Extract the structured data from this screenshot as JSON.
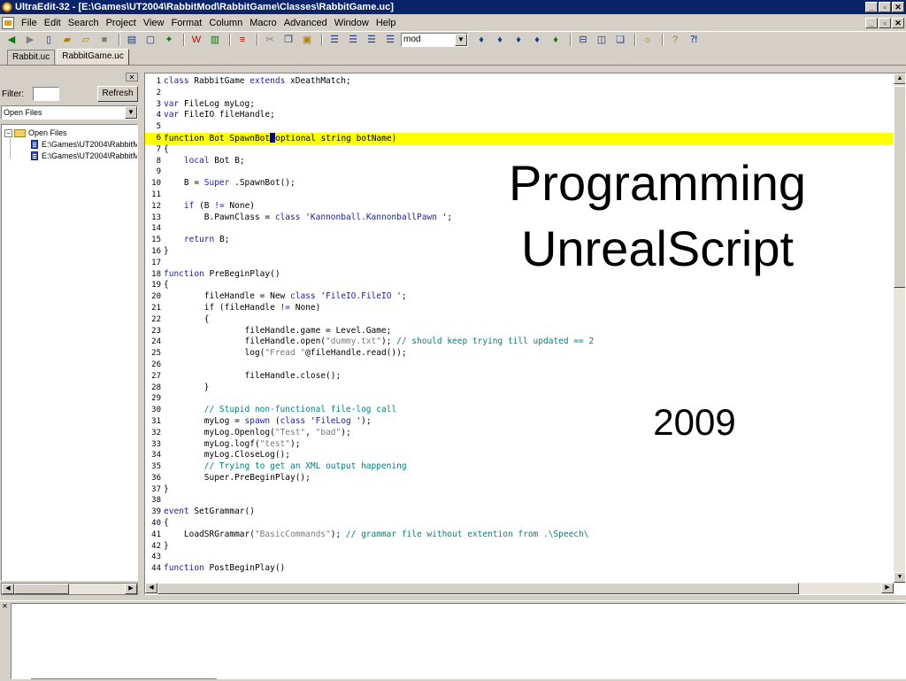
{
  "window": {
    "title": "UltraEdit-32 - [E:\\Games\\UT2004\\RabbitMod\\RabbitGame\\Classes\\RabbitGame.uc]",
    "buttons": [
      "_",
      "▫",
      "✕"
    ]
  },
  "menu": {
    "items": [
      "File",
      "Edit",
      "Search",
      "Project",
      "View",
      "Format",
      "Column",
      "Macro",
      "Advanced",
      "Window",
      "Help"
    ]
  },
  "toolbar": {
    "search_combo_value": "mod"
  },
  "tabs": [
    "Rabbit.uc",
    "RabbitGame.uc"
  ],
  "left_pane": {
    "filter_label": "Filter:",
    "refresh_label": "Refresh",
    "view_select": "Open Files",
    "tree": {
      "root": "Open Files",
      "files": [
        "E:\\Games\\UT2004\\RabbitM",
        "E:\\Games\\UT2004\\RabbitM"
      ]
    }
  },
  "editor": {
    "highlight_line": 6,
    "lines": [
      {
        "n": "1",
        "parts": [
          [
            "kw",
            "class"
          ],
          [
            "",
            "RabbitGame "
          ],
          [
            "kw",
            "extends"
          ],
          [
            "",
            "xDeathMatch;"
          ]
        ]
      },
      {
        "n": "2",
        "parts": []
      },
      {
        "n": "3",
        "parts": [
          [
            "kw",
            "var"
          ],
          [
            "",
            "FileLog myLog;"
          ]
        ]
      },
      {
        "n": "4",
        "parts": [
          [
            "kw",
            "var"
          ],
          [
            "",
            "FileIO fileHandle;"
          ]
        ]
      },
      {
        "n": "5",
        "parts": []
      },
      {
        "n": "6",
        "parts": [
          [
            "",
            "function Bot SpawnBot"
          ],
          [
            "cursor",
            ""
          ],
          [
            "",
            "optional string botName)"
          ]
        ]
      },
      {
        "n": "7",
        "parts": [
          [
            "",
            "{"
          ]
        ]
      },
      {
        "n": "8",
        "parts": [
          [
            "",
            "    "
          ],
          [
            "kw",
            "local"
          ],
          [
            "",
            "Bot B;"
          ]
        ]
      },
      {
        "n": "9",
        "parts": []
      },
      {
        "n": "10",
        "parts": [
          [
            "",
            "    B = "
          ],
          [
            "kw",
            "Super"
          ],
          [
            "",
            ".SpawnBot();"
          ]
        ]
      },
      {
        "n": "11",
        "parts": []
      },
      {
        "n": "12",
        "parts": [
          [
            "",
            "    "
          ],
          [
            "kw",
            "if"
          ],
          [
            "",
            "(B "
          ],
          [
            "kw",
            "!="
          ],
          [
            "",
            "None)"
          ]
        ]
      },
      {
        "n": "13",
        "parts": [
          [
            "",
            "        B.PawnClass = "
          ],
          [
            "kw",
            "class"
          ],
          [
            "",
            "'"
          ],
          [
            "kw",
            "Kannonball.KannonballPawn"
          ],
          [
            "",
            "';"
          ]
        ]
      },
      {
        "n": "14",
        "parts": []
      },
      {
        "n": "15",
        "parts": [
          [
            "",
            "    "
          ],
          [
            "kw",
            "return"
          ],
          [
            "",
            "B;"
          ]
        ]
      },
      {
        "n": "16",
        "parts": [
          [
            "",
            "}"
          ]
        ]
      },
      {
        "n": "17",
        "parts": []
      },
      {
        "n": "18",
        "parts": [
          [
            "kw",
            "function"
          ],
          [
            "",
            "PreBeginPlay()"
          ]
        ]
      },
      {
        "n": "19",
        "parts": [
          [
            "",
            "{"
          ]
        ]
      },
      {
        "n": "20",
        "parts": [
          [
            "",
            "        fileHandle = New "
          ],
          [
            "kw",
            "class"
          ],
          [
            "",
            "'"
          ],
          [
            "kw",
            "FileIO.FileIO"
          ],
          [
            "",
            "';"
          ]
        ]
      },
      {
        "n": "21",
        "parts": [
          [
            "",
            "        if (fileHandle "
          ],
          [
            "kw",
            "!="
          ],
          [
            "",
            "None)"
          ]
        ]
      },
      {
        "n": "22",
        "parts": [
          [
            "",
            "        {"
          ]
        ]
      },
      {
        "n": "23",
        "parts": [
          [
            "",
            "                fileHandle.game = Level.Game;"
          ]
        ]
      },
      {
        "n": "24",
        "parts": [
          [
            "",
            "                fileHandle.open("
          ],
          [
            "str",
            "\"dummy.txt\""
          ],
          [
            "",
            "); "
          ],
          [
            "cm",
            "// should keep trying till updated == 2"
          ]
        ]
      },
      {
        "n": "25",
        "parts": [
          [
            "",
            "                log("
          ],
          [
            "str",
            "\"Fread \""
          ],
          [
            "",
            "@fileHandle.read());"
          ]
        ]
      },
      {
        "n": "26",
        "parts": []
      },
      {
        "n": "27",
        "parts": [
          [
            "",
            "                fileHandle.close();"
          ]
        ]
      },
      {
        "n": "28",
        "parts": [
          [
            "",
            "        }"
          ]
        ]
      },
      {
        "n": "29",
        "parts": []
      },
      {
        "n": "30",
        "parts": [
          [
            "",
            "        "
          ],
          [
            "cm",
            "// Stupid non-functional file-log call"
          ]
        ]
      },
      {
        "n": "31",
        "parts": [
          [
            "",
            "        myLog = "
          ],
          [
            "kw",
            "spawn"
          ],
          [
            "",
            "("
          ],
          [
            "kw",
            "class"
          ],
          [
            "",
            "'"
          ],
          [
            "kw",
            "FileLog"
          ],
          [
            "",
            "');"
          ]
        ]
      },
      {
        "n": "32",
        "parts": [
          [
            "",
            "        myLog.Openlog("
          ],
          [
            "str",
            "\"Test\""
          ],
          [
            "",
            ", "
          ],
          [
            "str",
            "\"bad\""
          ],
          [
            "",
            ");"
          ]
        ]
      },
      {
        "n": "33",
        "parts": [
          [
            "",
            "        myLog.logf("
          ],
          [
            "str",
            "\"test\""
          ],
          [
            "",
            ");"
          ]
        ]
      },
      {
        "n": "34",
        "parts": [
          [
            "",
            "        myLog.CloseLog();"
          ]
        ]
      },
      {
        "n": "35",
        "parts": [
          [
            "",
            "        "
          ],
          [
            "cm",
            "// Trying to get an XML output happening"
          ]
        ]
      },
      {
        "n": "36",
        "parts": [
          [
            "",
            "        Super.PreBeginPlay();"
          ]
        ]
      },
      {
        "n": "37",
        "parts": [
          [
            "",
            "}"
          ]
        ]
      },
      {
        "n": "38",
        "parts": []
      },
      {
        "n": "39",
        "parts": [
          [
            "kw",
            "event"
          ],
          [
            "",
            "SetGrammar()"
          ]
        ]
      },
      {
        "n": "40",
        "parts": [
          [
            "",
            "{"
          ]
        ]
      },
      {
        "n": "41",
        "parts": [
          [
            "",
            "    LoadSRGrammar("
          ],
          [
            "str",
            "\"BasicCommands\""
          ],
          [
            "",
            "); "
          ],
          [
            "cm",
            "// grammar file without extention from .\\Speech\\"
          ]
        ]
      },
      {
        "n": "42",
        "parts": [
          [
            "",
            "}"
          ]
        ]
      },
      {
        "n": "43",
        "parts": []
      },
      {
        "n": "44",
        "parts": [
          [
            "kw",
            "function"
          ],
          [
            "",
            "PostBeginPlay()"
          ]
        ]
      }
    ]
  },
  "overlay": {
    "title_line1": "Programming",
    "title_line2": "UnrealScript",
    "year": "2009"
  }
}
